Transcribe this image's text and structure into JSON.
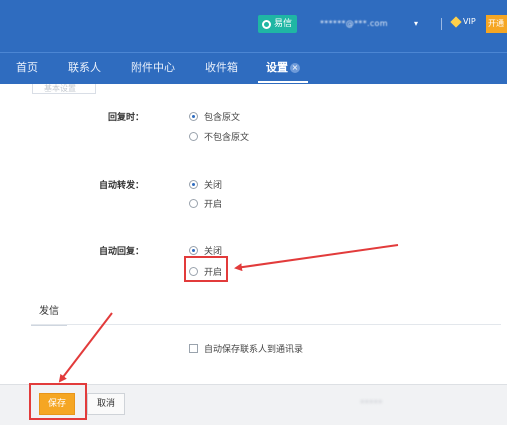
{
  "header": {
    "yixin_label": "易信",
    "account": "******@***.com",
    "vip_label": "VIP",
    "upgrade_label": "开通"
  },
  "nav": {
    "items": [
      {
        "label": "首页"
      },
      {
        "label": "联系人"
      },
      {
        "label": "附件中心"
      },
      {
        "label": "收件箱"
      },
      {
        "label": "设置"
      }
    ],
    "close_glyph": "×"
  },
  "settings": {
    "top_tab_fragment": "基本设置",
    "reply": {
      "label": "回复时：",
      "options": [
        "包含原文",
        "不包含原文"
      ],
      "selected": 0
    },
    "auto_forward": {
      "label": "自动转发：",
      "options": [
        "关闭",
        "开启"
      ],
      "selected": 0
    },
    "auto_reply": {
      "label": "自动回复：",
      "options": [
        "关闭",
        "开启"
      ],
      "selected": 0
    },
    "send_section": {
      "tab_label": "发信",
      "auto_save_contacts": "自动保存联系人到通讯录",
      "auto_save_checked": false
    }
  },
  "footer": {
    "save_label": "保存",
    "cancel_label": "取消",
    "watermark": "*****"
  },
  "colors": {
    "header_bg": "#2f6cbf",
    "accent_orange": "#f5a623",
    "annotation_red": "#e23b3b",
    "yixin_green": "#1fb6a4"
  }
}
